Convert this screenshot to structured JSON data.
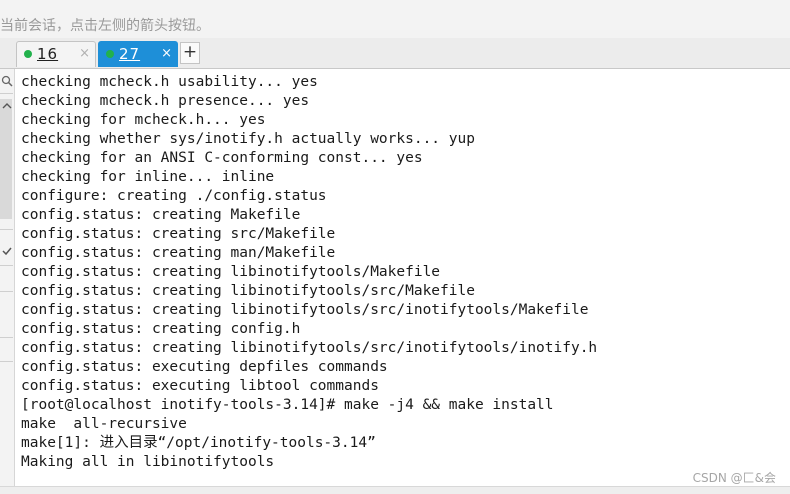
{
  "hint_text": "当前会话，点击左侧的箭头按钮。",
  "tabs": [
    {
      "label": "16",
      "status": "connected",
      "close": "×"
    },
    {
      "label": "27",
      "status": "connected",
      "close": "×"
    }
  ],
  "add_tab_label": "+",
  "terminal_lines": [
    "checking mcheck.h usability... yes",
    "checking mcheck.h presence... yes",
    "checking for mcheck.h... yes",
    "checking whether sys/inotify.h actually works... yup",
    "checking for an ANSI C-conforming const... yes",
    "checking for inline... inline",
    "configure: creating ./config.status",
    "config.status: creating Makefile",
    "config.status: creating src/Makefile",
    "config.status: creating man/Makefile",
    "config.status: creating libinotifytools/Makefile",
    "config.status: creating libinotifytools/src/Makefile",
    "config.status: creating libinotifytools/src/inotifytools/Makefile",
    "config.status: creating config.h",
    "config.status: creating libinotifytools/src/inotifytools/inotify.h",
    "config.status: executing depfiles commands",
    "config.status: executing libtool commands",
    "[root@localhost inotify-tools-3.14]# make -j4 && make install",
    "make  all-recursive",
    "make[1]: 进入目录“/opt/inotify-tools-3.14”",
    "Making all in libinotifytools"
  ],
  "watermark": "CSDN @匚&会",
  "colors": {
    "active_tab": "#1e8fd8",
    "status_dot": "#22b14c"
  },
  "icons": [
    "search-icon",
    "chevron-up-icon",
    "check-icon"
  ]
}
